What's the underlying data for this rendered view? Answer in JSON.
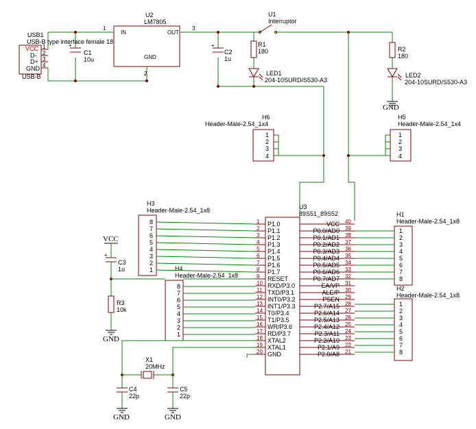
{
  "usb1": {
    "ref": "USB1",
    "value": "USB-B type interface female 180°",
    "footprint": "USB-B",
    "pins": [
      "VCC",
      "D-",
      "D+",
      "GND"
    ],
    "pin_numbers": [
      "1",
      "2",
      "3",
      "4"
    ]
  },
  "u2": {
    "ref": "U2",
    "value": "LM7805",
    "pin_in": "IN",
    "pin_out": "OUT",
    "pin_gnd": "GND",
    "n1": "1",
    "n2": "2",
    "n3": "3"
  },
  "u1": {
    "ref": "U1",
    "value": "Interruptor"
  },
  "c1": {
    "ref": "C1",
    "value": "10u"
  },
  "c2": {
    "ref": "C2",
    "value": "1u"
  },
  "c3": {
    "ref": "C3",
    "value": "1u"
  },
  "c4": {
    "ref": "C4",
    "value": "22p"
  },
  "c5": {
    "ref": "C5",
    "value": "22p"
  },
  "r1": {
    "ref": "R1",
    "value": "180"
  },
  "r2": {
    "ref": "R2",
    "value": "180"
  },
  "r3": {
    "ref": "R3",
    "value": "10k"
  },
  "led1": {
    "ref": "LED1",
    "value": "204-10SURD/S530-A3"
  },
  "led2": {
    "ref": "LED2",
    "value": "204-10SURD/S530-A3"
  },
  "x1": {
    "ref": "X1",
    "value": "20MHz"
  },
  "h6": {
    "ref": "H6",
    "value": "Header-Male-2.54_1x4",
    "pins": [
      "1",
      "2",
      "3",
      "4"
    ]
  },
  "h5": {
    "ref": "H5",
    "value": "Header-Male-2.54_1x4",
    "pins": [
      "1",
      "2",
      "3",
      "4"
    ]
  },
  "h3": {
    "ref": "H3",
    "value": "Header-Male-2.54_1x8",
    "pins": [
      "8",
      "7",
      "6",
      "5",
      "4",
      "3",
      "2",
      "1"
    ]
  },
  "h4": {
    "ref": "H4",
    "value": "Header-Male-2.54_1x8",
    "pins": [
      "8",
      "7",
      "6",
      "5",
      "4",
      "3",
      "2",
      "1"
    ]
  },
  "h1": {
    "ref": "H1",
    "value": "Header-Male-2.54_1x8",
    "pins": [
      "1",
      "2",
      "3",
      "4",
      "5",
      "6",
      "7",
      "8"
    ]
  },
  "h2": {
    "ref": "H2",
    "value": "Header-Male-2.54_1x8",
    "pins": [
      "1",
      "2",
      "3",
      "4",
      "5",
      "6",
      "7",
      "8"
    ]
  },
  "u3": {
    "ref": "U3",
    "value": "89S51_89S52",
    "left_pins": [
      {
        "n": "1",
        "name": "P1.0"
      },
      {
        "n": "2",
        "name": "P1.1"
      },
      {
        "n": "3",
        "name": "P1.2"
      },
      {
        "n": "4",
        "name": "P1.3"
      },
      {
        "n": "5",
        "name": "P1.4"
      },
      {
        "n": "6",
        "name": "P1.5"
      },
      {
        "n": "7",
        "name": "P1.6"
      },
      {
        "n": "8",
        "name": "P1.7"
      },
      {
        "n": "9",
        "name": "RESET"
      },
      {
        "n": "10",
        "name": "RXD/P3.0"
      },
      {
        "n": "11",
        "name": "TXD/P3.1"
      },
      {
        "n": "12",
        "name": "INT0/P3.2"
      },
      {
        "n": "13",
        "name": "INT1/P3.3"
      },
      {
        "n": "14",
        "name": "T0/P3.4"
      },
      {
        "n": "15",
        "name": "T1/P3.5"
      },
      {
        "n": "16",
        "name": "WR/P3.6"
      },
      {
        "n": "17",
        "name": "RD/P3.7"
      },
      {
        "n": "18",
        "name": "XTAL2"
      },
      {
        "n": "19",
        "name": "XTAL1"
      },
      {
        "n": "20",
        "name": "GND"
      }
    ],
    "right_pins": [
      {
        "n": "40",
        "name": "VCC"
      },
      {
        "n": "39",
        "name": "P0.0/AD0"
      },
      {
        "n": "38",
        "name": "P0.1/AD1"
      },
      {
        "n": "37",
        "name": "P0.2/AD2"
      },
      {
        "n": "36",
        "name": "P0.3/AD3"
      },
      {
        "n": "35",
        "name": "P0.4/AD4"
      },
      {
        "n": "34",
        "name": "P0.5/AD5"
      },
      {
        "n": "33",
        "name": "P0.6/AD6"
      },
      {
        "n": "32",
        "name": "P0.7/AD7"
      },
      {
        "n": "31",
        "name": "EA/VP"
      },
      {
        "n": "30",
        "name": "ALE/P"
      },
      {
        "n": "29",
        "name": "PSEN"
      },
      {
        "n": "28",
        "name": "P2.7/A15"
      },
      {
        "n": "27",
        "name": "P2.6/A14"
      },
      {
        "n": "26",
        "name": "P2.5/A13"
      },
      {
        "n": "25",
        "name": "P2.4/A12"
      },
      {
        "n": "24",
        "name": "P2.3/A11"
      },
      {
        "n": "23",
        "name": "P2.2/A10"
      },
      {
        "n": "22",
        "name": "P2.1/A9"
      },
      {
        "n": "21",
        "name": "P2.0/A8"
      }
    ]
  },
  "labels": {
    "vcc": "VCC",
    "gnd": "GND"
  }
}
